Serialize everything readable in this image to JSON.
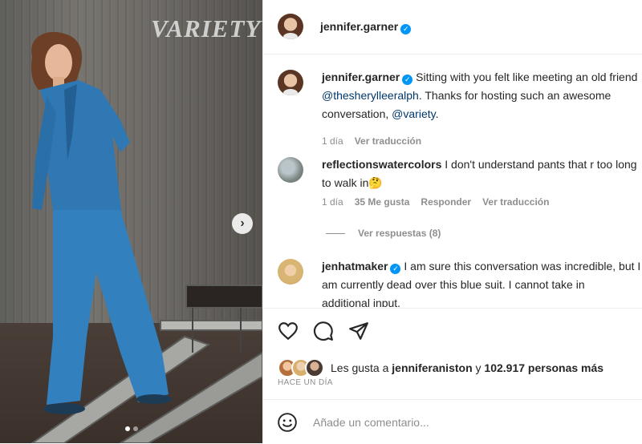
{
  "photo": {
    "watermark": "VARIETY",
    "next_icon": "chevron-right-icon",
    "carousel_dots": 2,
    "active_dot": 1
  },
  "header": {
    "username": "jennifer.garner",
    "verified": true
  },
  "comments": [
    {
      "username": "jennifer.garner",
      "verified": true,
      "line1": "Sitting with you felt like meeting an old friend",
      "line2_mention": "@thesherylleeralph",
      "line2_rest": ". Thanks for hosting such an awesome",
      "line3_text": "conversation, ",
      "line3_mention": "@variety",
      "line3_end": ".",
      "time": "1 día",
      "translate": "Ver traducción"
    },
    {
      "username": "reflectionswatercolors",
      "line1": "I don't understand pants that r too long",
      "line2": "to walk in",
      "emoji": "🤔",
      "time": "1 día",
      "likes": "35 Me gusta",
      "reply": "Responder",
      "translate": "Ver traducción",
      "view_replies": "Ver respuestas (8)"
    },
    {
      "username": "jenhatmaker",
      "verified": true,
      "line1": "I am sure this conversation was incredible, but I",
      "line2": "am currently dead over this blue suit. I cannot take in",
      "line3": "additional input."
    }
  ],
  "actions": {
    "like_icon": "heart-icon",
    "comment_icon": "comment-icon",
    "share_icon": "send-icon"
  },
  "likes": {
    "prefix": "Les gusta a ",
    "user": "jenniferaniston",
    "middle": " y ",
    "count": "102.917 personas más"
  },
  "timestamp": "HACE UN DÍA",
  "add_comment": {
    "emoji_icon": "smiley-icon",
    "placeholder": "Añade un comentario..."
  },
  "colors": {
    "verified_blue": "#0095f6",
    "mention_blue": "#00376b",
    "muted_gray": "#8e8e8e",
    "suit_blue": "#2f78b4"
  }
}
